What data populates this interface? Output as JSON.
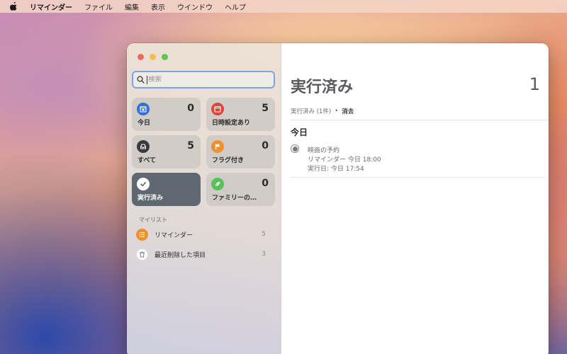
{
  "menubar": {
    "app_name": "リマインダー",
    "items": [
      "ファイル",
      "編集",
      "表示",
      "ウインドウ",
      "ヘルプ"
    ]
  },
  "search": {
    "placeholder": "検索"
  },
  "smart_lists": [
    {
      "label": "今日",
      "count": "0",
      "icon": "calendar-today-icon",
      "color": "#2f6fe0"
    },
    {
      "label": "日時設定あり",
      "count": "5",
      "icon": "calendar-icon",
      "color": "#e0453a"
    },
    {
      "label": "すべて",
      "count": "5",
      "icon": "tray-icon",
      "color": "#3a3a3c"
    },
    {
      "label": "フラグ付き",
      "count": "0",
      "icon": "flag-icon",
      "color": "#f0902a"
    },
    {
      "label": "実行済み",
      "count": "",
      "icon": "checkmark-icon",
      "color": "#ffffff"
    },
    {
      "label": "ファミリーの…",
      "count": "0",
      "icon": "leaf-icon",
      "color": "#5ac05a"
    }
  ],
  "my_lists": {
    "section_label": "マイリスト",
    "items": [
      {
        "name": "リマインダー",
        "count": "5",
        "icon": "list-bullet-icon",
        "color": "#f0902a"
      },
      {
        "name": "最近削除した項目",
        "count": "3",
        "icon": "trash-icon",
        "color": "#ffffff"
      }
    ]
  },
  "main": {
    "title": "実行済み",
    "count": "1",
    "completed_summary": "実行済み (1件)",
    "dot": "•",
    "clear_label": "消去",
    "section_title": "今日",
    "reminders": [
      {
        "title": "映画の予約",
        "meta": "リマインダー  今日 18:00",
        "completed": "実行日: 今日 17:54"
      }
    ]
  }
}
